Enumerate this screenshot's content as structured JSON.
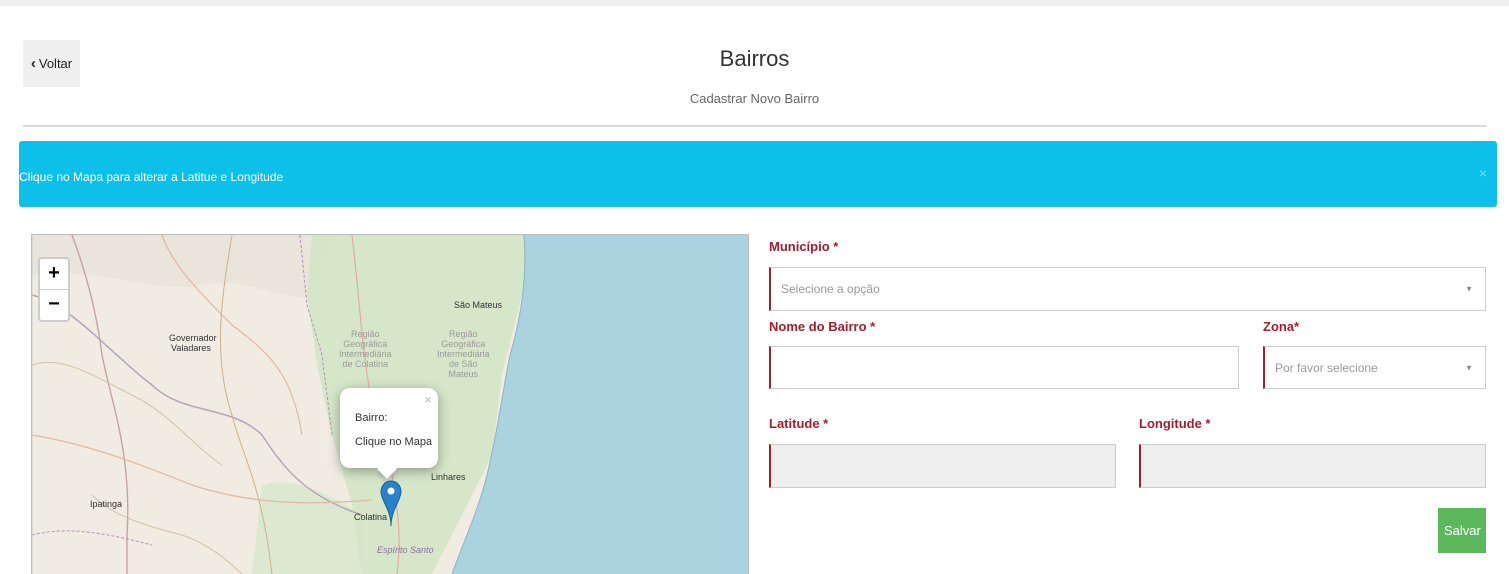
{
  "header": {
    "back_label": "Voltar",
    "title": "Bairros",
    "subtitle": "Cadastrar Novo Bairro"
  },
  "alert": {
    "message": "Clique no Mapa para alterar a Latitue e Longitude",
    "close": "×"
  },
  "map": {
    "zoom_in": "+",
    "zoom_out": "−",
    "labels": {
      "sao_mateus": "São Mateus",
      "governador": "Governador",
      "valadares": "Valadares",
      "regiao_colatina": [
        "Região",
        "Geográfica",
        "Intermediária",
        "de Colatina"
      ],
      "regiao_sao_mateus": [
        "Região",
        "Geográfica",
        "Intermediária",
        "de São",
        "Mateus"
      ],
      "linhares": "Linhares",
      "ipatinga": "Ipatinga",
      "colatina": "Colatina",
      "espirito_santo": "Espírito Santo"
    },
    "popup": {
      "line1": "Bairro:",
      "line2": "Clique no Mapa",
      "close": "×"
    },
    "colors": {
      "sea": "#aad3df",
      "land": "#f0ece2",
      "green": "#cfe6c3",
      "marker": "#2a81cb"
    }
  },
  "form": {
    "municipio": {
      "label": "Município *",
      "placeholder": "Selecione a opção"
    },
    "nome_bairro": {
      "label": "Nome do Bairro *",
      "value": ""
    },
    "zona": {
      "label": "Zona*",
      "placeholder": "Por favor selecione"
    },
    "latitude": {
      "label": "Latitude *",
      "value": ""
    },
    "longitude": {
      "label": "Longitude *",
      "value": ""
    },
    "save_label": "Salvar",
    "caret": "▼"
  },
  "colors": {
    "alert_bg": "#0cc0ea",
    "required_label": "#a71d2a",
    "save_bg": "#5cb85c"
  }
}
